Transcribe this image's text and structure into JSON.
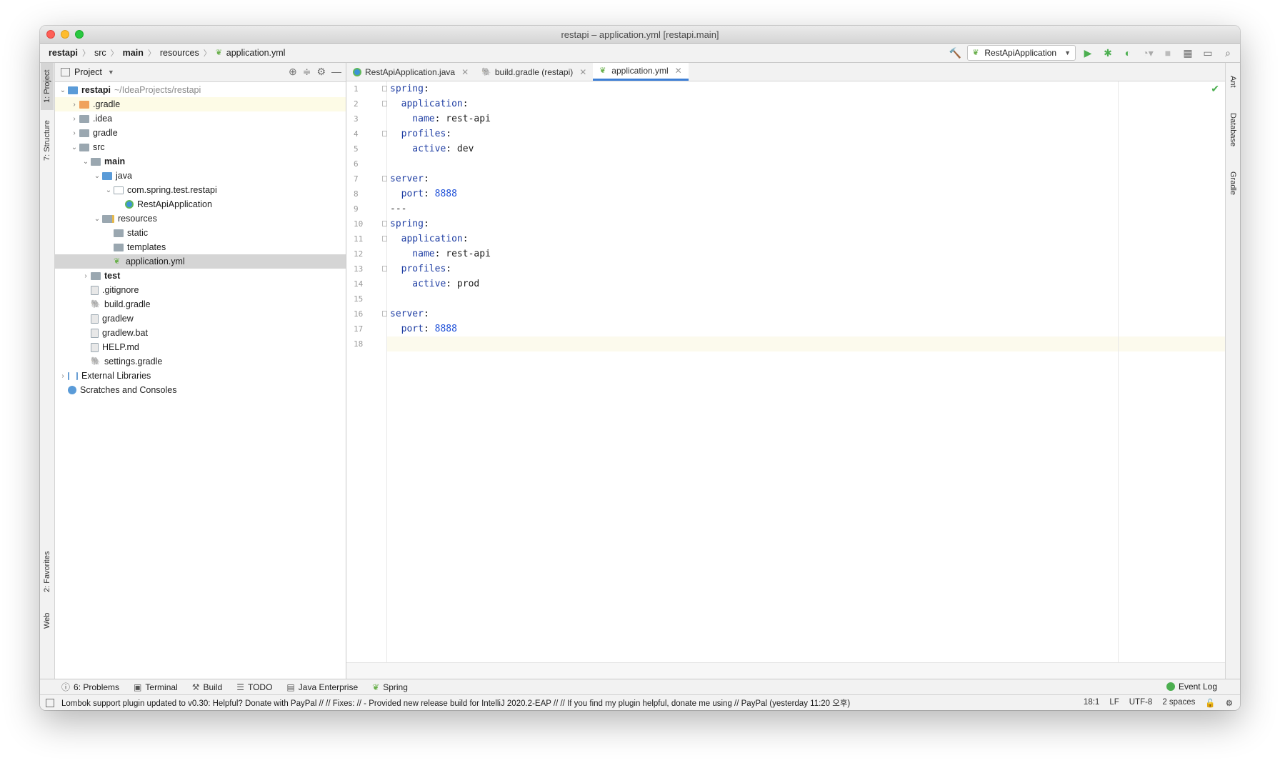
{
  "window": {
    "title": "restapi – application.yml [restapi.main]"
  },
  "breadcrumb": [
    "restapi",
    "src",
    "main",
    "resources",
    "application.yml"
  ],
  "run_config": {
    "label": "RestApiApplication"
  },
  "left_tabs": {
    "project": "1: Project",
    "structure": "7: Structure",
    "favorites": "2: Favorites",
    "web": "Web"
  },
  "right_tabs": {
    "ant": "Ant",
    "database": "Database",
    "gradle": "Gradle"
  },
  "project_panel": {
    "title": "Project",
    "root_name": "restapi",
    "root_path": "~/IdeaProjects/restapi",
    "items": [
      ".gradle",
      ".idea",
      "gradle",
      "src",
      "main",
      "java",
      "com.spring.test.restapi",
      "RestApiApplication",
      "resources",
      "static",
      "templates",
      "application.yml",
      "test",
      ".gitignore",
      "build.gradle",
      "gradlew",
      "gradlew.bat",
      "HELP.md",
      "settings.gradle",
      "External Libraries",
      "Scratches and Consoles"
    ]
  },
  "editor_tabs": [
    "RestApiApplication.java",
    "build.gradle (restapi)",
    "application.yml"
  ],
  "code": {
    "line_numbers": [
      "1",
      "2",
      "3",
      "4",
      "5",
      "6",
      "7",
      "8",
      "9",
      "10",
      "11",
      "12",
      "13",
      "14",
      "15",
      "16",
      "17",
      "18"
    ],
    "lines": [
      {
        "key": "spring",
        "sep": ":",
        "val": ""
      },
      {
        "key": "  application",
        "sep": ":",
        "val": ""
      },
      {
        "key": "    name",
        "sep": ":",
        "val": " rest-api"
      },
      {
        "key": "  profiles",
        "sep": ":",
        "val": ""
      },
      {
        "key": "    active",
        "sep": ":",
        "val": " dev"
      },
      {
        "key": "",
        "sep": "",
        "val": ""
      },
      {
        "key": "server",
        "sep": ":",
        "val": ""
      },
      {
        "key": "  port",
        "sep": ":",
        "num": " 8888"
      },
      {
        "key": "",
        "sep": "",
        "val": "---"
      },
      {
        "key": "spring",
        "sep": ":",
        "val": ""
      },
      {
        "key": "  application",
        "sep": ":",
        "val": ""
      },
      {
        "key": "    name",
        "sep": ":",
        "val": " rest-api"
      },
      {
        "key": "  profiles",
        "sep": ":",
        "val": ""
      },
      {
        "key": "    active",
        "sep": ":",
        "val": " prod"
      },
      {
        "key": "",
        "sep": "",
        "val": ""
      },
      {
        "key": "server",
        "sep": ":",
        "val": ""
      },
      {
        "key": "  port",
        "sep": ":",
        "num": " 8888"
      },
      {
        "key": "",
        "sep": "",
        "val": ""
      }
    ]
  },
  "tool_windows": [
    "6: Problems",
    "Terminal",
    "Build",
    "TODO",
    "Java Enterprise",
    "Spring"
  ],
  "event_log": "Event Log",
  "status": {
    "message": "Lombok support plugin updated to v0.30: Helpful? Donate with PayPal // // Fixes: // - Provided new release build for IntelliJ 2020.2-EAP // // If you find my plugin helpful, donate me using // PayPal (yesterday 11:20 오후)",
    "position": "18:1",
    "line_sep": "LF",
    "encoding": "UTF-8",
    "indent": "2 spaces"
  }
}
